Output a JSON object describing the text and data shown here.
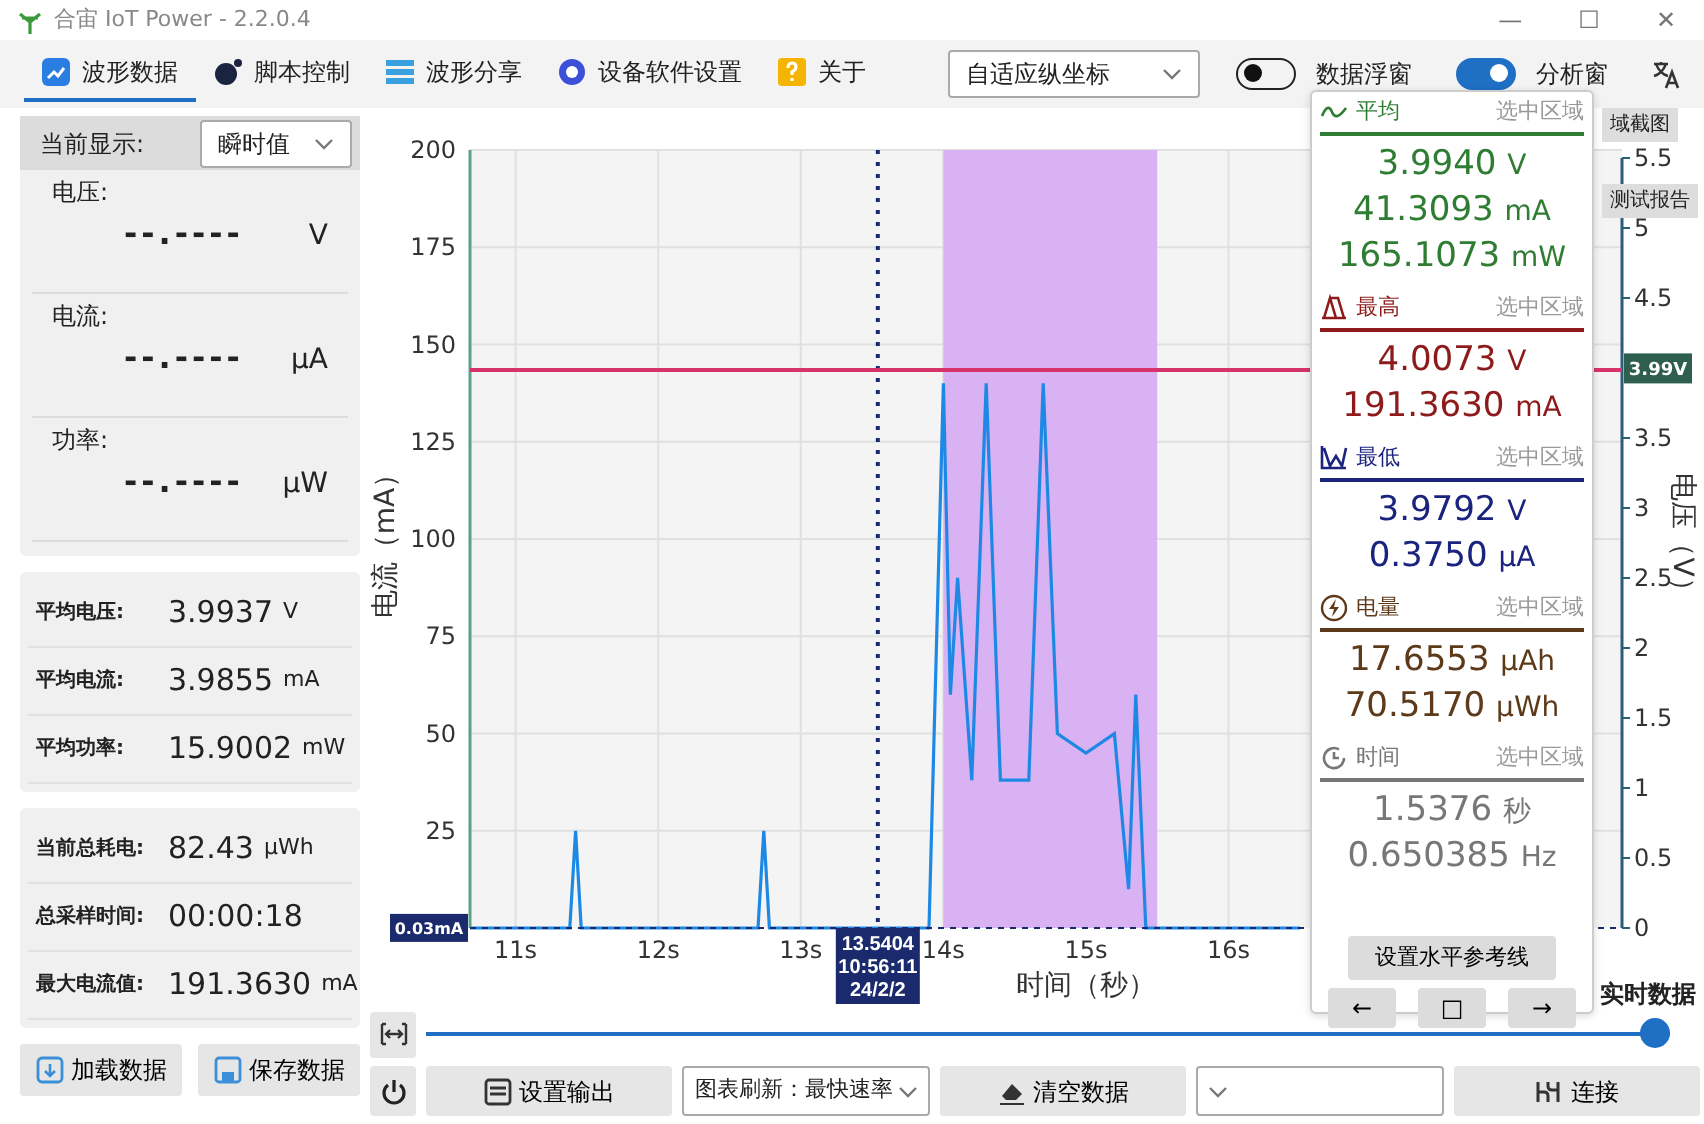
{
  "window": {
    "title": "合宙 IoT Power - 2.2.0.4",
    "controls": [
      "—",
      "☐",
      "✕"
    ]
  },
  "tabs": [
    {
      "label": "波形数据",
      "kind": "wave",
      "selected": true
    },
    {
      "label": "脚本控制",
      "kind": "script",
      "selected": false
    },
    {
      "label": "波形分享",
      "kind": "share",
      "selected": false
    },
    {
      "label": "设备软件设置",
      "kind": "settings",
      "selected": false
    },
    {
      "label": "关于",
      "kind": "about",
      "selected": false
    }
  ],
  "toolbar": {
    "scale_select": "自适应纵坐标",
    "toggles": [
      {
        "label": "数据浮窗",
        "on": false
      },
      {
        "label": "分析窗",
        "on": true
      }
    ]
  },
  "left_panel": {
    "display_label": "当前显示:",
    "display_select": "瞬时值",
    "live": [
      {
        "label": "电压:",
        "value": "--.----",
        "unit": "V"
      },
      {
        "label": "电流:",
        "value": "--.----",
        "unit": "μA"
      },
      {
        "label": "功率:",
        "value": "--.----",
        "unit": "μW"
      }
    ],
    "averages": [
      {
        "label": "平均电压:",
        "value": "3.9937",
        "unit": "V"
      },
      {
        "label": "平均电流:",
        "value": "3.9855",
        "unit": "mA"
      },
      {
        "label": "平均功率:",
        "value": "15.9002",
        "unit": "mW"
      }
    ],
    "totals": [
      {
        "label": "当前总耗电:",
        "value": "82.43",
        "unit": "μWh"
      },
      {
        "label": "总采样时间:",
        "value": "00:00:18"
      },
      {
        "label": "最大电流值:",
        "value": "191.3630",
        "unit": "mA"
      }
    ],
    "buttons": [
      {
        "label": "加载数据",
        "kind": "load"
      },
      {
        "label": "保存数据",
        "kind": "save"
      }
    ]
  },
  "chart": {
    "chart_data": {
      "type": "line",
      "xlabel": "时间（秒）",
      "ylabel": "电流（mA）",
      "xlim": [
        10.68,
        18.76
      ],
      "ylim": [
        0,
        200
      ],
      "grid": true,
      "xticks": [
        {
          "value": 11,
          "label": "11s"
        },
        {
          "value": 12,
          "label": "12s"
        },
        {
          "value": 13,
          "label": "13s"
        },
        {
          "value": 14,
          "label": "14s"
        },
        {
          "value": 15,
          "label": "15s"
        },
        {
          "value": 16,
          "label": "16s"
        }
      ],
      "yticks": [
        25,
        50,
        75,
        100,
        125,
        150,
        175,
        200
      ],
      "x": [
        10.68,
        11.38,
        11.42,
        11.46,
        12.7,
        12.74,
        12.78,
        13.9,
        14.0,
        14.05,
        14.1,
        14.2,
        14.3,
        14.4,
        14.6,
        14.7,
        14.8,
        15.0,
        15.2,
        15.3,
        15.35,
        15.42,
        16.5
      ],
      "series": [
        {
          "color": "#1e88e5",
          "values": [
            0,
            0,
            25,
            0,
            0,
            25,
            0,
            0,
            140,
            60,
            90,
            38,
            140,
            38,
            38,
            140,
            50,
            45,
            50,
            10,
            60,
            0,
            0
          ]
        }
      ],
      "bands": [
        {
          "axis": "x",
          "from": 14.0,
          "to": 15.5
        }
      ],
      "ref_lines": [
        {
          "axis": "x",
          "value": 13.5404,
          "label": "13.5404"
        },
        {
          "axis": "y",
          "value": 0.03,
          "label": "0.03mA"
        }
      ]
    },
    "cursor_time": [
      "10:56:11",
      "24/2/2"
    ],
    "y2label": "电压（V）",
    "y2ticks": [
      "5.5",
      "5",
      "4.5",
      "3.5",
      "3",
      "2.5",
      "2",
      "1.5",
      "1",
      "0.5",
      "0"
    ],
    "reference": {
      "label": "3.99V"
    },
    "overlay_buttons": [
      "域截图",
      "测试报告"
    ],
    "mode_label": "实时数据"
  },
  "analysis": {
    "sections": [
      {
        "kind": "average",
        "title": "平均",
        "scope": "选中区域",
        "color": "#2e7d32",
        "values": [
          {
            "value": "3.9940",
            "unit": "V"
          },
          {
            "value": "41.3093",
            "unit": "mA"
          },
          {
            "value": "165.1073",
            "unit": "mW"
          }
        ]
      },
      {
        "kind": "max",
        "title": "最高",
        "scope": "选中区域",
        "color": "#8e1b1b",
        "values": [
          {
            "value": "4.0073",
            "unit": "V"
          },
          {
            "value": "191.3630",
            "unit": "mA"
          }
        ]
      },
      {
        "kind": "min",
        "title": "最低",
        "scope": "选中区域",
        "color": "#1a237e",
        "values": [
          {
            "value": "3.9792",
            "unit": "V"
          },
          {
            "value": "0.3750",
            "unit": "μA"
          }
        ]
      },
      {
        "kind": "energy",
        "title": "电量",
        "scope": "选中区域",
        "color": "#5d3a1a",
        "values": [
          {
            "value": "17.6553",
            "unit": "μAh"
          },
          {
            "value": "70.5170",
            "unit": "μWh"
          }
        ]
      },
      {
        "kind": "time",
        "title": "时间",
        "scope": "选中区域",
        "color": "#777777",
        "values": [
          {
            "value": "1.5376",
            "unit": "秒"
          },
          {
            "value": "0.650385",
            "unit": "Hz"
          }
        ]
      }
    ],
    "ref_button": "设置水平参考线",
    "nav": [
      "←",
      "□",
      "→"
    ]
  },
  "slider": {
    "level": 1.0
  },
  "bottom_bar": {
    "output_button": "设置输出",
    "refresh_select": "图表刷新：最快速率",
    "clear_button": "清空数据",
    "connect_button": "连接"
  }
}
